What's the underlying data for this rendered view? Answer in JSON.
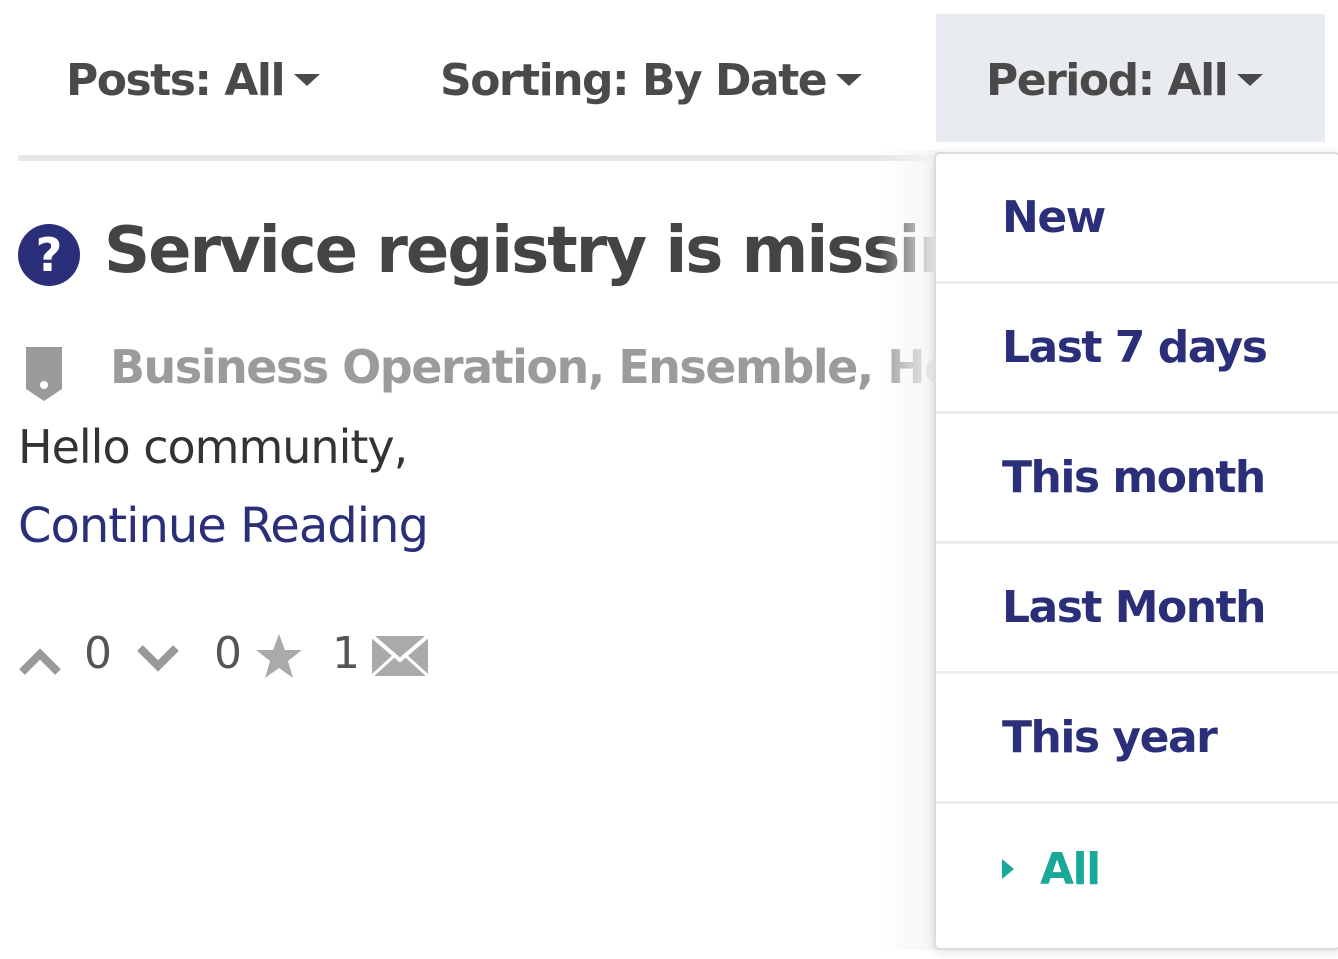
{
  "filters": {
    "posts_label": "Posts:",
    "posts_value": "All",
    "sorting_label": "Sorting:",
    "sorting_value": "By Date",
    "period_label": "Period:",
    "period_value": "All"
  },
  "post": {
    "title": "Service registry is missing",
    "tags": "Business Operation, Ensemble, Hea",
    "excerpt": "Hello community,",
    "continue_label": "Continue Reading",
    "upvotes": "0",
    "downvotes": "0",
    "bookmarks": "1"
  },
  "period_menu": {
    "items": [
      "New",
      "Last 7 days",
      "This month",
      "Last Month",
      "This year",
      "All"
    ],
    "selected": "All"
  },
  "colors": {
    "accent": "#2b2f7a",
    "selected": "#1aa89a",
    "muted": "#9b9b9b"
  },
  "icons": {
    "question": "question-circle-icon",
    "tag": "tag-icon",
    "up": "chevron-up-icon",
    "down": "chevron-down-icon",
    "star": "star-icon",
    "mail": "envelope-icon"
  }
}
